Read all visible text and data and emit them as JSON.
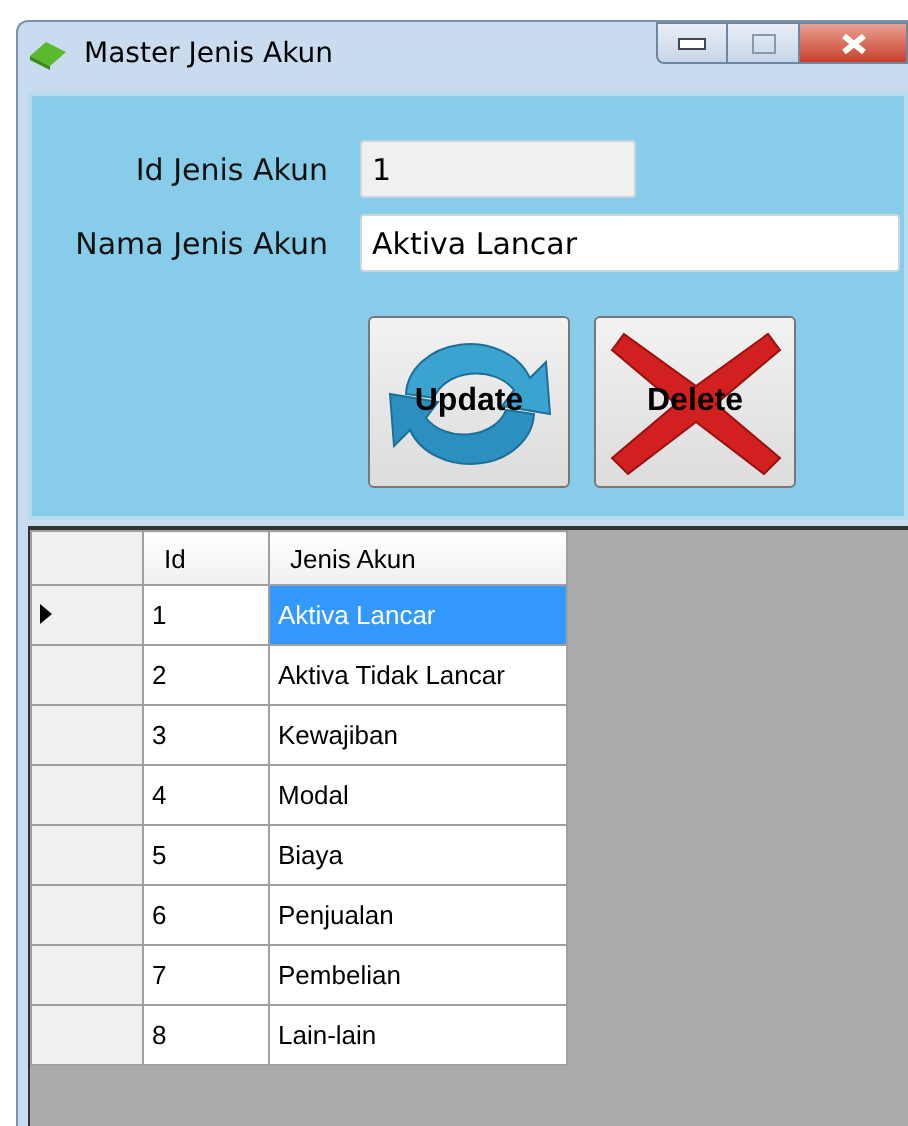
{
  "window": {
    "title": "Master Jenis Akun"
  },
  "form": {
    "fields": [
      {
        "label": "Id Jenis Akun",
        "value": "1",
        "disabled": true
      },
      {
        "label": "Nama Jenis Akun",
        "value": "Aktiva Lancar",
        "disabled": false
      }
    ],
    "buttons": [
      {
        "label": "Update",
        "kind": "update"
      },
      {
        "label": "Delete",
        "kind": "delete"
      }
    ]
  },
  "table": {
    "columns": [
      "Id",
      "Jenis Akun"
    ],
    "rows": [
      {
        "cells": [
          "1",
          "Aktiva Lancar"
        ],
        "selected": true
      },
      {
        "cells": [
          "2",
          "Aktiva Tidak Lancar"
        ],
        "selected": false
      },
      {
        "cells": [
          "3",
          "Kewajiban"
        ],
        "selected": false
      },
      {
        "cells": [
          "4",
          "Modal"
        ],
        "selected": false
      },
      {
        "cells": [
          "5",
          "Biaya"
        ],
        "selected": false
      },
      {
        "cells": [
          "6",
          "Penjualan"
        ],
        "selected": false
      },
      {
        "cells": [
          "7",
          "Pembelian"
        ],
        "selected": false
      },
      {
        "cells": [
          "8",
          "Lain-lain"
        ],
        "selected": false
      }
    ]
  }
}
